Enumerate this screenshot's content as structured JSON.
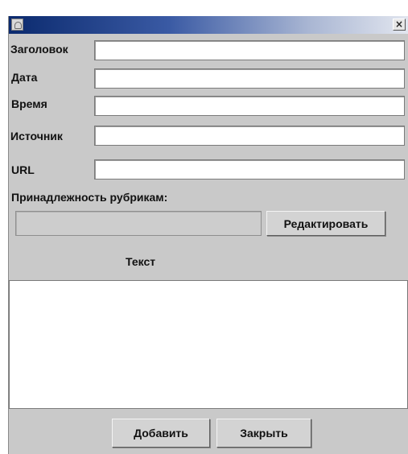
{
  "window": {
    "app_icon": "app-icon",
    "close_label": "×"
  },
  "form": {
    "title_label": "Заголовок",
    "date_label": "Дата",
    "time_label": "Время",
    "source_label": "Источник",
    "url_label": "URL",
    "title_value": "",
    "date_value": "",
    "time_value": "",
    "source_value": "",
    "url_value": ""
  },
  "rubrics": {
    "label": "Принадлежность рубрикам:",
    "value": "",
    "edit_button": "Редактировать"
  },
  "text_section": {
    "label": "Текст",
    "value": ""
  },
  "footer": {
    "add_button": "Добавить",
    "close_button": "Закрыть"
  }
}
